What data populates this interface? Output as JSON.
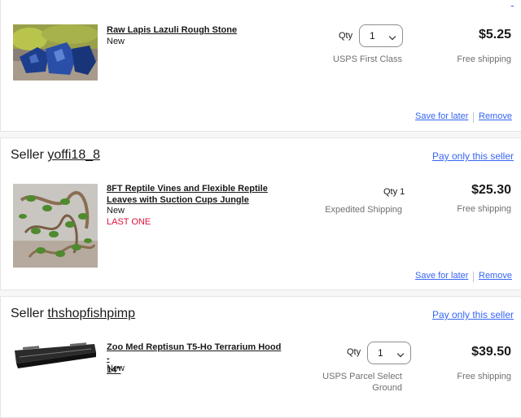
{
  "sellers": [
    {
      "name": "",
      "item": {
        "title": "Raw Lapis Lazuli Rough Stone",
        "condition": "New",
        "qty_label": "Qty",
        "qty_value": "1",
        "shipping_method": "USPS First Class",
        "price": "$5.25",
        "shipping_cost": "Free shipping"
      },
      "save_label": "Save for later",
      "remove_label": "Remove"
    },
    {
      "prefix": "Seller",
      "name": "yoffi18_8",
      "pay_label": "Pay only this seller",
      "item": {
        "title_line1": "8FT Reptile Vines and Flexible Reptile",
        "title_line2": "Leaves with Suction Cups Jungle",
        "condition": "New",
        "stock_note": "LAST ONE",
        "qty_text": "Qty 1",
        "shipping_method": "Expedited Shipping",
        "price": "$25.30",
        "shipping_cost": "Free shipping"
      },
      "save_label": "Save for later",
      "remove_label": "Remove"
    },
    {
      "prefix": "Seller",
      "name": "thshopfishpimp",
      "pay_label": "Pay only this seller",
      "item": {
        "title_line1": "Zoo Med Reptisun T5-Ho Terrarium Hood -",
        "title_line2": "14\"",
        "condition": "New",
        "qty_label": "Qty",
        "qty_value": "1",
        "shipping_method_line1": "USPS Parcel Select",
        "shipping_method_line2": "Ground",
        "price": "$39.50",
        "shipping_cost": "Free shipping"
      }
    }
  ],
  "colors": {
    "link": "#3665f3",
    "alert": "#e0103a",
    "muted": "#707070"
  },
  "icons": [
    "chevron-down-icon"
  ]
}
